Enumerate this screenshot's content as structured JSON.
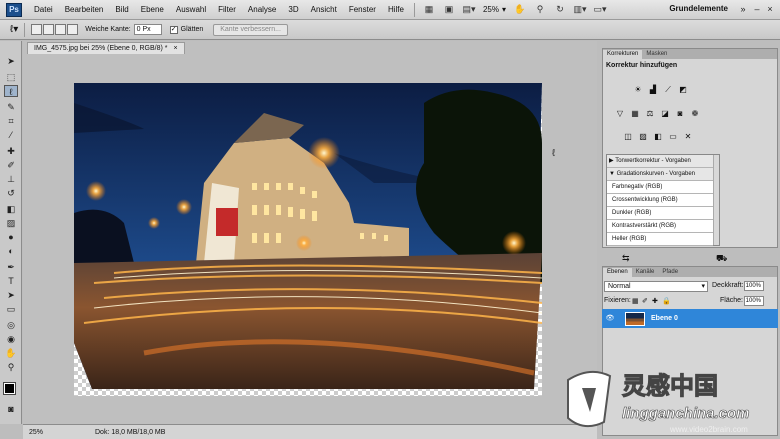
{
  "menubar": {
    "logo": "Ps",
    "items": [
      "Datei",
      "Bearbeiten",
      "Bild",
      "Ebene",
      "Auswahl",
      "Filter",
      "Analyse",
      "3D",
      "Ansicht",
      "Fenster",
      "Hilfe"
    ],
    "zoom": "25%",
    "workspace": "Grundelemente"
  },
  "options": {
    "feather_label": "Weiche Kante:",
    "feather_value": "0 Px",
    "antialias_label": "Glätten",
    "refine_edge": "Kante verbessern..."
  },
  "document": {
    "tab_title": "IMG_4575.jpg bei 25% (Ebene 0, RGB/8) *",
    "close": "×"
  },
  "status": {
    "zoom": "25%",
    "doc_info": "Dok: 18,0 MB/18,0 MB"
  },
  "adjustments": {
    "tabs": [
      "Korrekturen",
      "Masken"
    ],
    "title": "Korrektur hinzufügen",
    "presets": [
      {
        "label": "Tonwertkorrektur - Vorgaben",
        "group": true
      },
      {
        "label": "Gradationskurven - Vorgaben",
        "group": true
      },
      {
        "label": "Farbnegativ (RGB)",
        "group": false
      },
      {
        "label": "Crossentwicklung (RGB)",
        "group": false
      },
      {
        "label": "Dunkler (RGB)",
        "group": false
      },
      {
        "label": "Kontrastverstärkt (RGB)",
        "group": false
      },
      {
        "label": "Heller (RGB)",
        "group": false
      }
    ]
  },
  "layers": {
    "tabs": [
      "Ebenen",
      "Kanäle",
      "Pfade"
    ],
    "blend_mode": "Normal",
    "opacity_label": "Deckkraft:",
    "opacity_value": "100%",
    "lock_label": "Fixieren:",
    "fill_label": "Fläche:",
    "fill_value": "100%",
    "layer_name": "Ebene 0"
  },
  "watermark": {
    "brand": "灵感中国",
    "url": "lingganchina.com",
    "sub": "www.video2brain.com"
  },
  "colors": {
    "selection_blue": "#2f86d9",
    "photo_sky": "#15305e",
    "photo_light": "#e2782a"
  }
}
